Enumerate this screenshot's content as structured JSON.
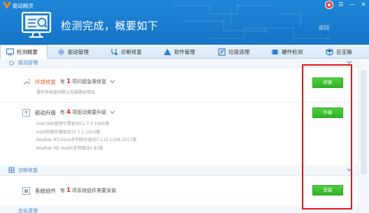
{
  "window": {
    "title": "驱动精灵",
    "headline": "检测完成，概要如下",
    "back_link": "返回"
  },
  "tabs": [
    {
      "label": "检测概要",
      "icon": "monitor-icon",
      "active": true
    },
    {
      "label": "驱动管理",
      "icon": "gear-icon",
      "active": false
    },
    {
      "label": "诊断修复",
      "icon": "stethoscope-icon",
      "active": false
    },
    {
      "label": "软件管理",
      "icon": "triangle-app-icon",
      "active": false
    },
    {
      "label": "垃圾清理",
      "icon": "broom-icon",
      "active": false
    },
    {
      "label": "硬件检测",
      "icon": "chip-icon",
      "active": false
    },
    {
      "label": "百宝箱",
      "icon": "box-icon",
      "active": false
    }
  ],
  "sections": {
    "driver": "驱动管理",
    "diagnose": "诊断修复",
    "optimize": "优化清理"
  },
  "items": {
    "env": {
      "title": "环境修复",
      "prefix": "有",
      "count": "1",
      "suffix": "项问题急需修复",
      "detail": "操作系统驱动默认安装路径错误",
      "button": "修复"
    },
    "upgrade": {
      "title": "驱动升级",
      "prefix": "有",
      "count": "4",
      "suffix": "项驱动需要升级",
      "details": [
        "Intel MEI管理引擎驱动11.7.0.1045版",
        "Intel快速存储驱动15.7.1.1015版",
        "Realtek RTL81xx系列网卡驱动7.115.1208.2017版",
        "Realtek HD Audio音频驱动2.81版"
      ],
      "button": "升级"
    },
    "component": {
      "title": "系统组件",
      "prefix": "有",
      "count": "1",
      "suffix": "项系统组件需要安装",
      "button": "安装"
    }
  },
  "colors": {
    "header": "#1a7cd0",
    "accent_green": "#36b828",
    "highlight": "#e8141e",
    "count_red": "#e02b2b"
  }
}
